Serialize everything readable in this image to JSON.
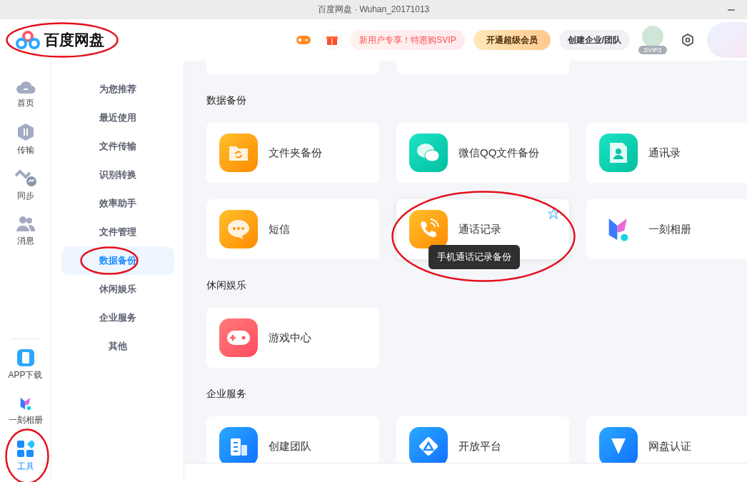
{
  "window": {
    "title": "百度网盘 · Wuhan_20171013"
  },
  "header": {
    "logo": {
      "text": "百度网盘",
      "circled": true
    },
    "promo": "新用户专享！特惠购SVIP",
    "vip_button": "开通超级会员",
    "team_button": "创建企业/团队",
    "vip_badge": "SVIP1"
  },
  "rail": {
    "items": [
      {
        "label": "首页",
        "kind": "cloud",
        "selected": false,
        "circled": false
      },
      {
        "label": "传输",
        "kind": "transfer",
        "selected": false,
        "circled": false
      },
      {
        "label": "同步",
        "kind": "sync",
        "selected": false,
        "circled": false
      },
      {
        "label": "消息",
        "kind": "people",
        "selected": false,
        "circled": false
      }
    ],
    "bottom_items": [
      {
        "label": "APP下载",
        "kind": "phone",
        "selected": false,
        "circled": false
      },
      {
        "label": "一刻相册",
        "kind": "album",
        "selected": false,
        "circled": false
      },
      {
        "label": "工具",
        "kind": "tools",
        "selected": true,
        "circled": true
      }
    ]
  },
  "nav": {
    "items": [
      {
        "label": "为您推荐",
        "selected": false,
        "circled": false
      },
      {
        "label": "最近使用",
        "selected": false,
        "circled": false
      },
      {
        "label": "文件传输",
        "selected": false,
        "circled": false
      },
      {
        "label": "识别转换",
        "selected": false,
        "circled": false
      },
      {
        "label": "效率助手",
        "selected": false,
        "circled": false
      },
      {
        "label": "文件管理",
        "selected": false,
        "circled": false
      },
      {
        "label": "数据备份",
        "selected": true,
        "circled": true
      },
      {
        "label": "休闲娱乐",
        "selected": false,
        "circled": false
      },
      {
        "label": "企业服务",
        "selected": false,
        "circled": false
      },
      {
        "label": "其他",
        "selected": false,
        "circled": false
      }
    ]
  },
  "sections": [
    {
      "title": "数据备份",
      "cards": [
        {
          "label": "文件夹备份",
          "kind": "folder",
          "hovered": false,
          "circled": false
        },
        {
          "label": "微信QQ文件备份",
          "kind": "chat",
          "hovered": false,
          "circled": false
        },
        {
          "label": "通讯录",
          "kind": "contact",
          "hovered": false,
          "circled": false
        },
        {
          "label": "短信",
          "kind": "sms",
          "hovered": false,
          "circled": false
        },
        {
          "label": "通话记录",
          "kind": "call",
          "hovered": true,
          "circled": true,
          "tooltip": "手机通话记录备份"
        },
        {
          "label": "一刻相册",
          "kind": "album",
          "hovered": false,
          "circled": false
        }
      ]
    },
    {
      "title": "休闲娱乐",
      "cards": [
        {
          "label": "游戏中心",
          "kind": "game",
          "hovered": false,
          "circled": false
        }
      ]
    },
    {
      "title": "企业服务",
      "cards": [
        {
          "label": "创建团队",
          "kind": "team",
          "hovered": false,
          "circled": false
        },
        {
          "label": "开放平台",
          "kind": "platform",
          "hovered": false,
          "circled": false
        },
        {
          "label": "网盘认证",
          "kind": "verify",
          "hovered": false,
          "circled": false
        }
      ]
    }
  ]
}
